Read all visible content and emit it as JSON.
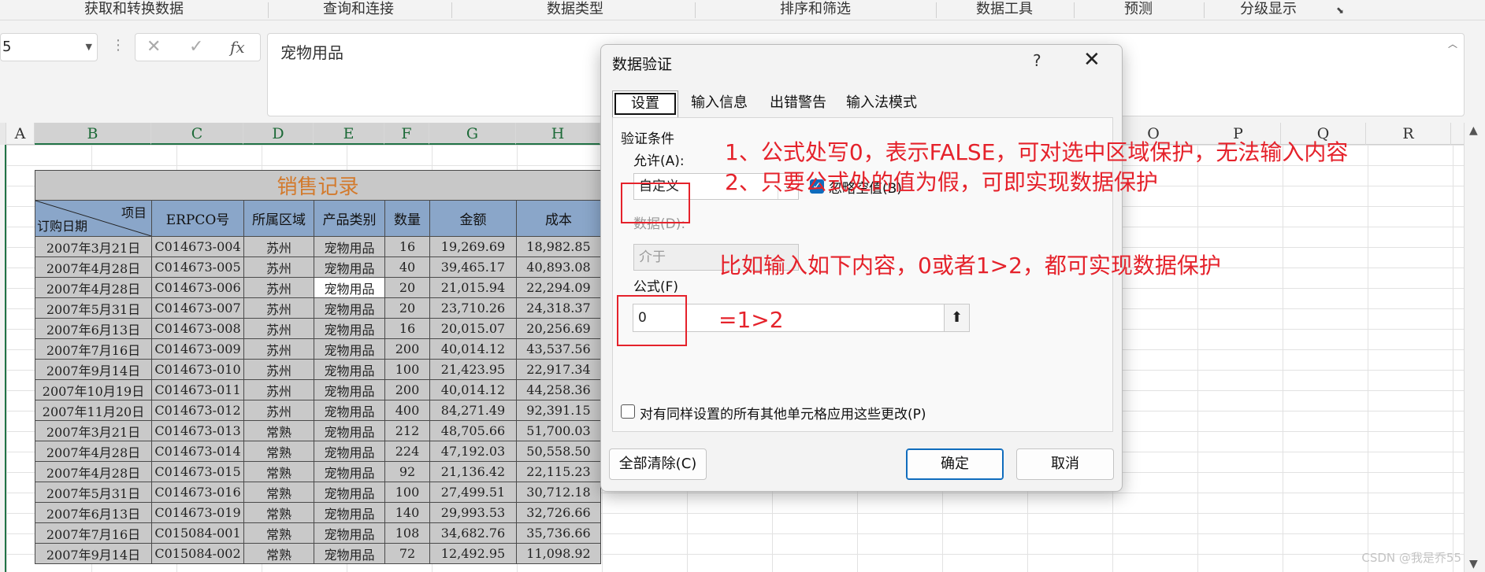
{
  "ribbon": {
    "groups": [
      "获取和转换数据",
      "查询和连接",
      "数据类型",
      "排序和筛选",
      "数据工具",
      "预测",
      "分级显示"
    ],
    "launcher_icon": "dialog-launcher-icon"
  },
  "formula_bar": {
    "name_box": "5",
    "cancel_icon": "✕",
    "enter_icon": "✓",
    "fx_icon": "fx",
    "content": "宠物用品"
  },
  "columns": [
    "A",
    "B",
    "C",
    "D",
    "E",
    "F",
    "G",
    "H",
    "O",
    "P",
    "Q",
    "R"
  ],
  "sheet": {
    "title": "销售记录",
    "header_item": "项目",
    "header_date": "订购日期",
    "headers": [
      "ERPCO号",
      "所属区域",
      "产品类别",
      "数量",
      "金额",
      "成本"
    ],
    "rows": [
      [
        "2007年3月21日",
        "C014673-004",
        "苏州",
        "宠物用品",
        "16",
        "19,269.69",
        "18,982.85"
      ],
      [
        "2007年4月28日",
        "C014673-005",
        "苏州",
        "宠物用品",
        "40",
        "39,465.17",
        "40,893.08"
      ],
      [
        "2007年4月28日",
        "C014673-006",
        "苏州",
        "宠物用品",
        "20",
        "21,015.94",
        "22,294.09"
      ],
      [
        "2007年5月31日",
        "C014673-007",
        "苏州",
        "宠物用品",
        "20",
        "23,710.26",
        "24,318.37"
      ],
      [
        "2007年6月13日",
        "C014673-008",
        "苏州",
        "宠物用品",
        "16",
        "20,015.07",
        "20,256.69"
      ],
      [
        "2007年7月16日",
        "C014673-009",
        "苏州",
        "宠物用品",
        "200",
        "40,014.12",
        "43,537.56"
      ],
      [
        "2007年9月14日",
        "C014673-010",
        "苏州",
        "宠物用品",
        "100",
        "21,423.95",
        "22,917.34"
      ],
      [
        "2007年10月19日",
        "C014673-011",
        "苏州",
        "宠物用品",
        "200",
        "40,014.12",
        "44,258.36"
      ],
      [
        "2007年11月20日",
        "C014673-012",
        "苏州",
        "宠物用品",
        "400",
        "84,271.49",
        "92,391.15"
      ],
      [
        "2007年3月21日",
        "C014673-013",
        "常熟",
        "宠物用品",
        "212",
        "48,705.66",
        "51,700.03"
      ],
      [
        "2007年4月28日",
        "C014673-014",
        "常熟",
        "宠物用品",
        "224",
        "47,192.03",
        "50,558.50"
      ],
      [
        "2007年4月28日",
        "C014673-015",
        "常熟",
        "宠物用品",
        "92",
        "21,136.42",
        "22,115.23"
      ],
      [
        "2007年5月31日",
        "C014673-016",
        "常熟",
        "宠物用品",
        "100",
        "27,499.51",
        "30,712.18"
      ],
      [
        "2007年6月13日",
        "C014673-019",
        "常熟",
        "宠物用品",
        "140",
        "29,993.53",
        "32,726.66"
      ],
      [
        "2007年7月16日",
        "C015084-001",
        "常熟",
        "宠物用品",
        "108",
        "34,682.76",
        "35,736.66"
      ],
      [
        "2007年9月14日",
        "C015084-002",
        "常熟",
        "宠物用品",
        "72",
        "12,492.95",
        "11,098.92"
      ]
    ]
  },
  "dialog": {
    "title": "数据验证",
    "help": "?",
    "close": "✕",
    "tabs": [
      "设置",
      "输入信息",
      "出错警告",
      "输入法模式"
    ],
    "section": "验证条件",
    "allow_label": "允许(A):",
    "allow_value": "自定义",
    "ignore_blank": "忽略空值(B)",
    "data_label": "数据(D):",
    "data_value": "介于",
    "formula_label": "公式(F)",
    "formula_value": "0",
    "apply_all": "对有同样设置的所有其他单元格应用这些更改(P)",
    "clear_all": "全部清除(C)",
    "ok": "确定",
    "cancel": "取消"
  },
  "annotations": {
    "note1": "1、公式处写0，表示FALSE，可对选中区域保护，无法输入内容",
    "note2": "2、只要公式处的值为假，可即实现数据保护",
    "note3": "比如输入如下内容，0或者1>2，都可实现数据保护",
    "note4": "=1>2",
    "color": "#e5222b"
  },
  "watermark": "CSDN @我是乔55"
}
